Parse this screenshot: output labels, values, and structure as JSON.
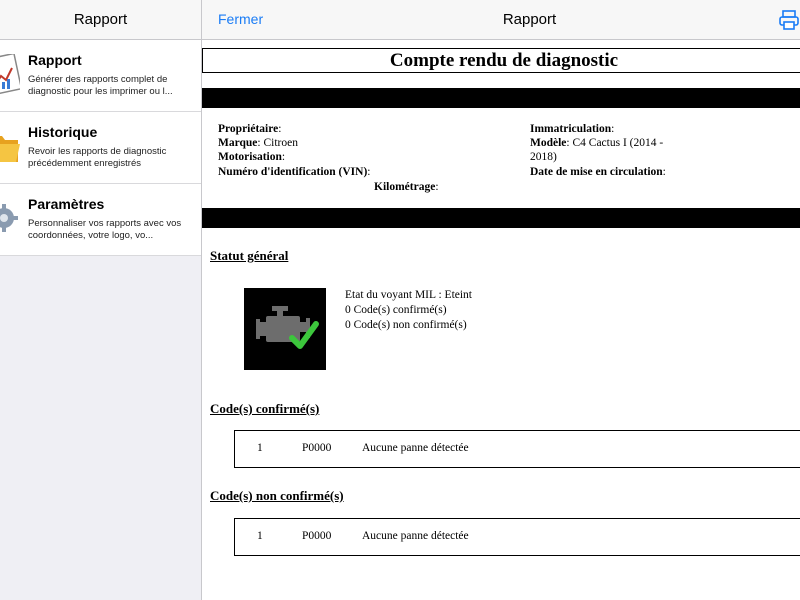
{
  "left_pane": {
    "nav_title": "Rapport",
    "items": [
      {
        "title": "Rapport",
        "description": "Générer des rapports complet de diagnostic pour les imprimer ou l...",
        "icon": "report-chart-icon"
      },
      {
        "title": "Historique",
        "description": "Revoir les rapports de diagnostic précédemment enregistrés",
        "icon": "folder-icon"
      },
      {
        "title": "Paramètres",
        "description": "Personnaliser vos rapports avec vos coordonnées, votre logo, vo...",
        "icon": "gear-icon"
      }
    ]
  },
  "right_pane": {
    "nav": {
      "close_label": "Fermer",
      "title": "Rapport",
      "print_icon": "printer-icon"
    },
    "report": {
      "title": "Compte rendu de diagnostic",
      "fields": {
        "owner_label": "Propriétaire",
        "owner_value": "",
        "brand_label": "Marque",
        "brand_value": "Citroen",
        "engine_label": "Motorisation",
        "engine_value": "",
        "vin_label": "Numéro d'identification (VIN)",
        "vin_value": "",
        "mileage_label": "Kilométrage",
        "mileage_value": "",
        "plate_label": "Immatriculation",
        "plate_value": "",
        "model_label": "Modèle",
        "model_value_1": "C4 Cactus I (2014 -",
        "model_value_2": "2018)",
        "registration_date_label": "Date de mise en circulation",
        "registration_date_value": ""
      },
      "general_status": {
        "heading": "Statut général",
        "icon": "engine-check-icon",
        "lines": [
          "Etat du voyant MIL : Eteint",
          "0 Code(s) confirmé(s)",
          "0 Code(s) non confirmé(s)"
        ]
      },
      "confirmed_codes": {
        "heading": "Code(s) confirmé(s)",
        "rows": [
          {
            "index": "1",
            "code": "P0000",
            "description": "Aucune panne détectée"
          }
        ]
      },
      "unconfirmed_codes": {
        "heading": "Code(s) non confirmé(s)",
        "rows": [
          {
            "index": "1",
            "code": "P0000",
            "description": "Aucune panne détectée"
          }
        ]
      }
    }
  },
  "colors": {
    "accent": "#1a7cf5",
    "nav_bg": "#f7f7f7",
    "sidebar_bg": "#efeff4",
    "check_green": "#3cc63c"
  }
}
